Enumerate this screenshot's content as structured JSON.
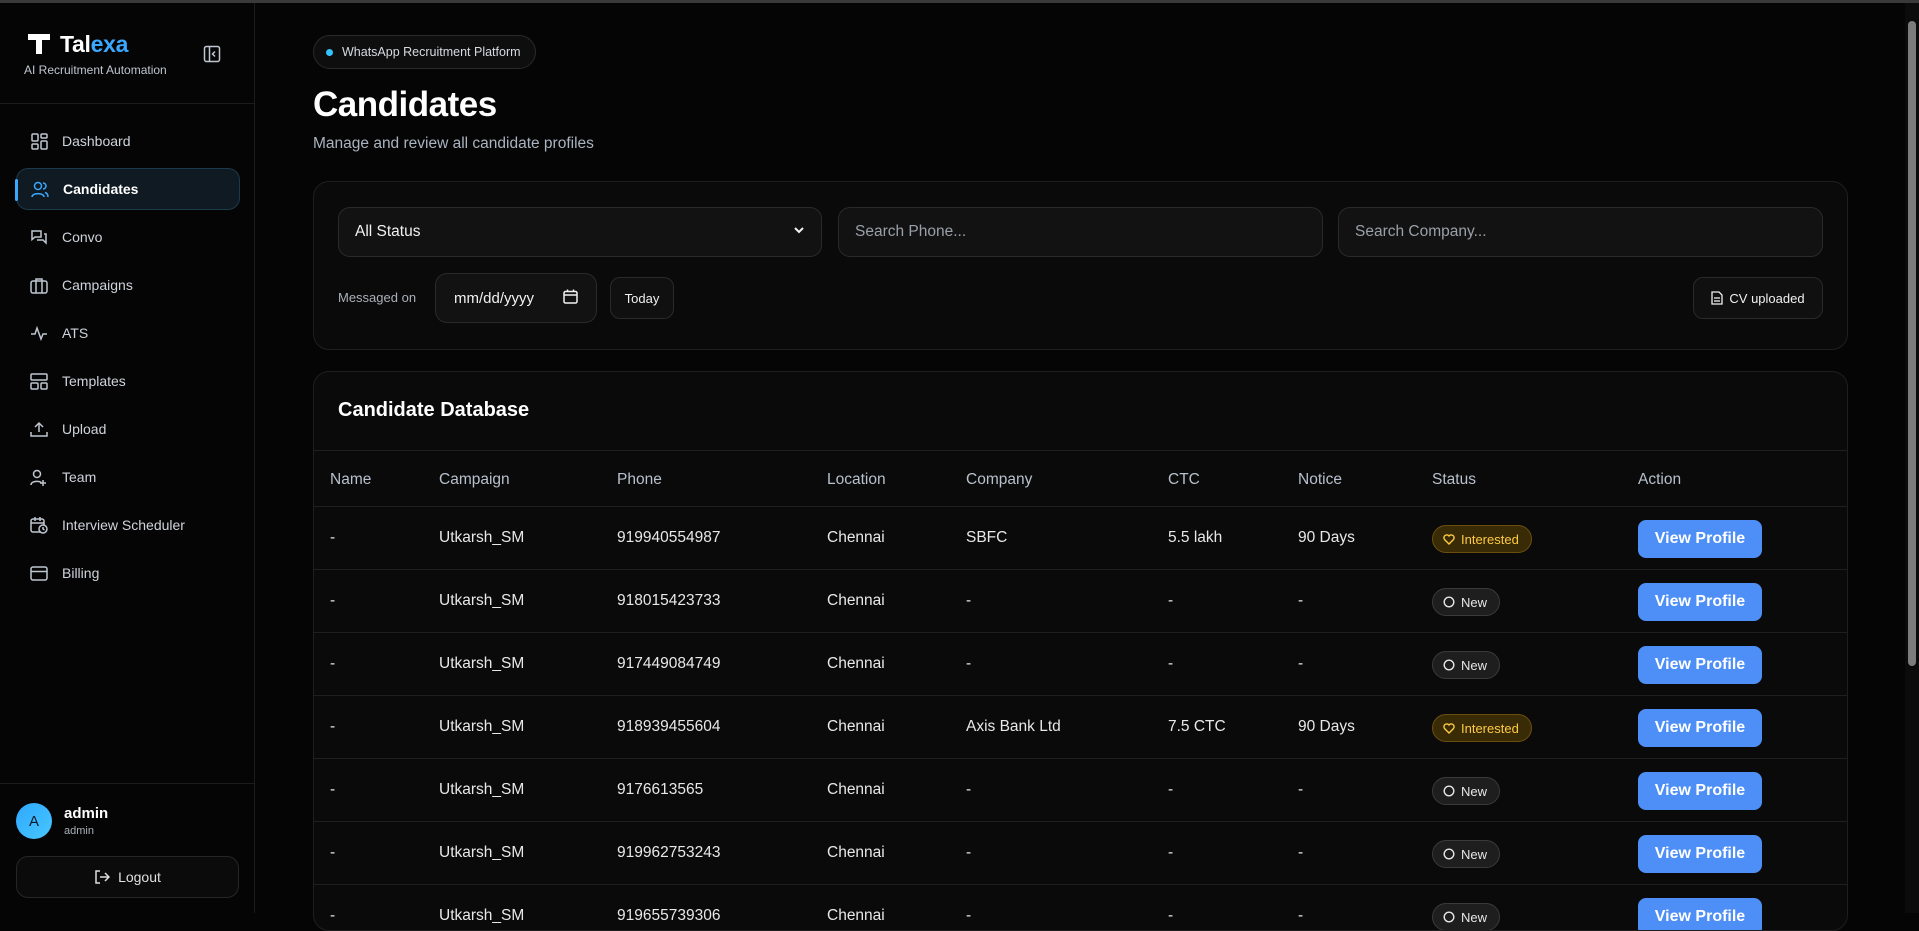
{
  "brand": {
    "name_main": "Tal",
    "name_accent": "exa",
    "subtitle": "AI Recruitment Automation"
  },
  "sidebar": {
    "items": [
      {
        "label": "Dashboard",
        "icon": "grid-icon"
      },
      {
        "label": "Candidates",
        "icon": "users-icon",
        "active": true
      },
      {
        "label": "Convo",
        "icon": "chat-icon"
      },
      {
        "label": "Campaigns",
        "icon": "briefcase-icon"
      },
      {
        "label": "ATS",
        "icon": "pulse-icon"
      },
      {
        "label": "Templates",
        "icon": "template-icon"
      },
      {
        "label": "Upload",
        "icon": "upload-icon"
      },
      {
        "label": "Team",
        "icon": "team-icon"
      },
      {
        "label": "Interview Scheduler",
        "icon": "calendar-clock-icon"
      },
      {
        "label": "Billing",
        "icon": "card-icon"
      }
    ],
    "user": {
      "initial": "A",
      "name": "admin",
      "role": "admin"
    },
    "logout_label": "Logout"
  },
  "header": {
    "pill_label": "WhatsApp Recruitment Platform",
    "title": "Candidates",
    "subtitle": "Manage and review all candidate profiles"
  },
  "filters": {
    "status_value": "All Status",
    "phone_placeholder": "Search Phone...",
    "company_placeholder": "Search Company...",
    "messaged_label": "Messaged on",
    "date_placeholder": "mm/dd/yyyy",
    "today_label": "Today",
    "cv_label": "CV uploaded"
  },
  "database": {
    "title": "Candidate Database",
    "columns": [
      "Name",
      "Campaign",
      "Phone",
      "Location",
      "Company",
      "CTC",
      "Notice",
      "Status",
      "Action"
    ],
    "action_label": "View Profile",
    "rows": [
      {
        "name": "-",
        "campaign": "Utkarsh_SM",
        "phone": "919940554987",
        "location": "Chennai",
        "company": "SBFC",
        "ctc": "5.5 lakh",
        "notice": "90 Days",
        "status": "Interested"
      },
      {
        "name": "-",
        "campaign": "Utkarsh_SM",
        "phone": "918015423733",
        "location": "Chennai",
        "company": "-",
        "ctc": "-",
        "notice": "-",
        "status": "New"
      },
      {
        "name": "-",
        "campaign": "Utkarsh_SM",
        "phone": "917449084749",
        "location": "Chennai",
        "company": "-",
        "ctc": "-",
        "notice": "-",
        "status": "New"
      },
      {
        "name": "-",
        "campaign": "Utkarsh_SM",
        "phone": "918939455604",
        "location": "Chennai",
        "company": "Axis Bank Ltd",
        "ctc": "7.5 CTC",
        "notice": "90 Days",
        "status": "Interested"
      },
      {
        "name": "-",
        "campaign": "Utkarsh_SM",
        "phone": "9176613565",
        "location": "Chennai",
        "company": "-",
        "ctc": "-",
        "notice": "-",
        "status": "New"
      },
      {
        "name": "-",
        "campaign": "Utkarsh_SM",
        "phone": "919962753243",
        "location": "Chennai",
        "company": "-",
        "ctc": "-",
        "notice": "-",
        "status": "New"
      },
      {
        "name": "-",
        "campaign": "Utkarsh_SM",
        "phone": "919655739306",
        "location": "Chennai",
        "company": "-",
        "ctc": "-",
        "notice": "-",
        "status": "New"
      }
    ]
  },
  "colors": {
    "accent": "#3aa8ff",
    "primary_button": "#4d8ef7",
    "interested": "#ffcb45"
  }
}
